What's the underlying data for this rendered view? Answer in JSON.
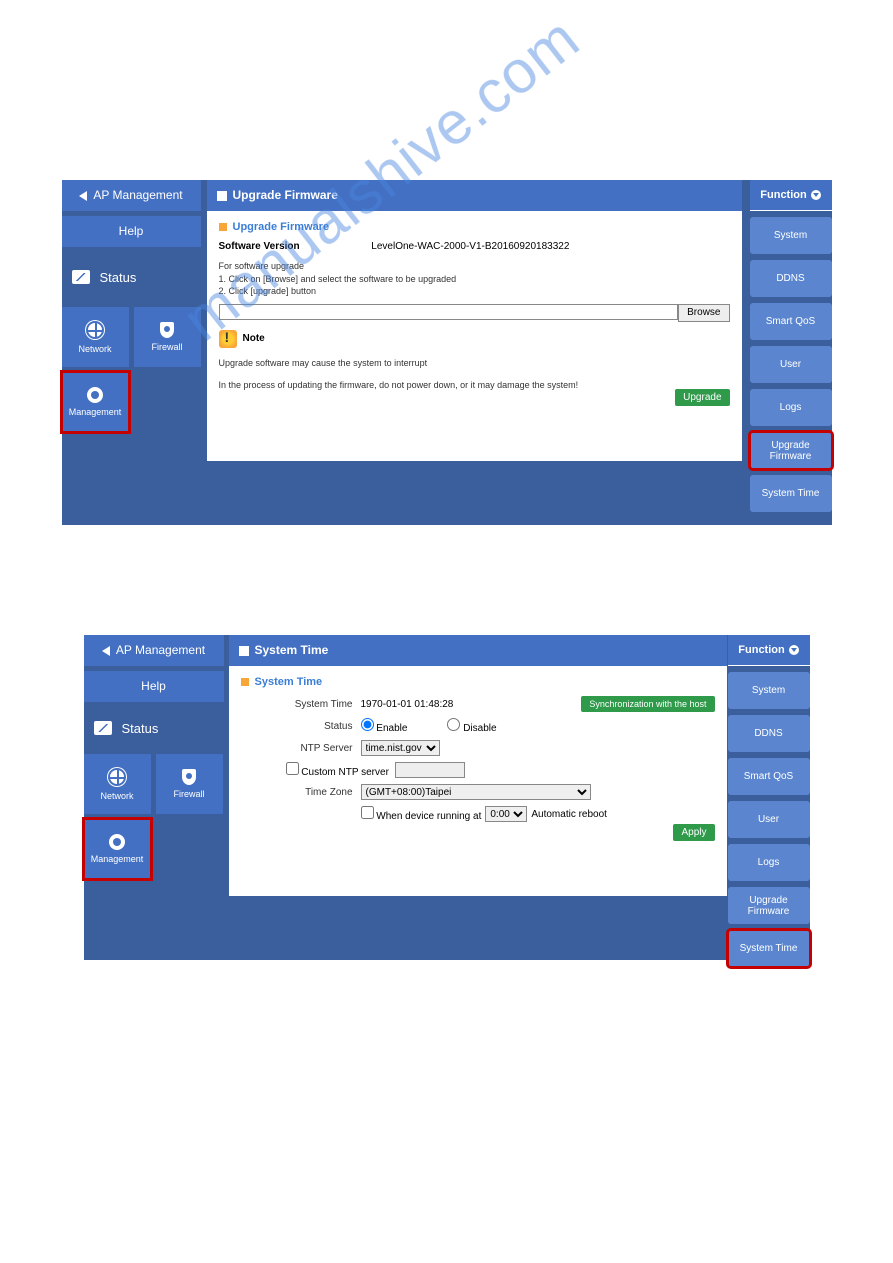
{
  "watermark": "manualshive.com",
  "nav": {
    "ap_management": "AP Management",
    "help": "Help",
    "status": "Status",
    "tiles": {
      "network": "Network",
      "firewall": "Firewall",
      "management": "Management"
    }
  },
  "screen1": {
    "title": "Upgrade Firmware",
    "subtitle": "Upgrade Firmware",
    "sw_label": "Software Version",
    "sw_value": "LevelOne-WAC-2000-V1-B20160920183322",
    "instr0": "For software upgrade",
    "instr1": "1. Click on [Browse] and select the software to be upgraded",
    "instr2": "2. Click [upgrade] button",
    "browse": "Browse",
    "note": "Note",
    "msg1": "Upgrade software may cause the system to interrupt",
    "msg2": "In the process of updating the firmware, do not power down, or it may damage the system!",
    "upgrade_btn": "Upgrade"
  },
  "screen2": {
    "title": "System Time",
    "subtitle": "System Time",
    "systime_label": "System Time",
    "systime_value": "1970-01-01 01:48:28",
    "sync_btn": "Synchronization with the host",
    "status_label": "Status",
    "enable": "Enable",
    "disable": "Disable",
    "ntp_label": "NTP Server",
    "ntp_value": "time.nist.gov",
    "custom_ntp": "Custom NTP server",
    "tz_label": "Time Zone",
    "tz_value": "(GMT+08:00)Taipei",
    "reboot_pre": "When device running at",
    "reboot_time": "0:00",
    "reboot_post": "Automatic reboot",
    "apply_btn": "Apply"
  },
  "function": {
    "header": "Function",
    "items": [
      "System",
      "DDNS",
      "Smart QoS",
      "User",
      "Logs",
      "Upgrade Firmware",
      "System Time"
    ]
  }
}
